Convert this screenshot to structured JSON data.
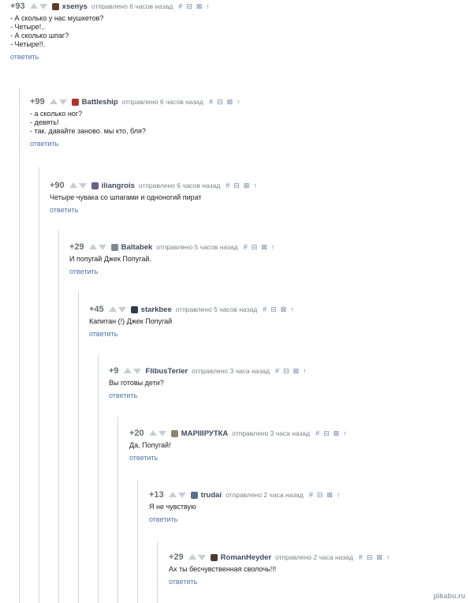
{
  "icons": {
    "hash": "#",
    "save": "⊟",
    "picture": "⊠",
    "parent": "↑"
  },
  "comments": [
    {
      "score": "+93",
      "user": "xsenys",
      "posted": "отправлено 6 часов назад",
      "avatar_color": "#5a3d2b",
      "lines": [
        "- А сколько у нас мушкетов?",
        "- Четыре!..",
        "- А сколько шпаг?",
        "- Четыре!!."
      ],
      "reply": "ответить"
    },
    {
      "score": "+99",
      "user": "Battleship",
      "posted": "отправлено 6 часов назад",
      "avatar_color": "#b0302a",
      "lines": [
        "- а сколько ног?",
        "- девять!",
        "- так. давайте заново. мы кто, бля?"
      ],
      "reply": "ответить"
    },
    {
      "score": "+90",
      "user": "iliangrois",
      "posted": "отправлено 6 часов назад",
      "avatar_color": "#6a5d8f",
      "lines": [
        "Четыре чувака со шпагами и одноногий пират"
      ],
      "reply": "ответить"
    },
    {
      "score": "+29",
      "user": "Baltabek",
      "posted": "отправлено 5 часов назад",
      "avatar_color": "#7b8a94",
      "lines": [
        "И попугай Джек Попугай."
      ],
      "reply": "ответить"
    },
    {
      "score": "+45",
      "user": "starkbee",
      "posted": "отправлено 5 часов назад",
      "avatar_color": "#2f3b4a",
      "lines": [
        "Капитан (!) Джек Попугай"
      ],
      "reply": "ответить"
    },
    {
      "score": "+9",
      "user": "FlibusTerier",
      "posted": "отправлено 3 часа назад",
      "avatar_color": "",
      "lines": [
        "Вы готовы дети?"
      ],
      "reply": "ответить"
    },
    {
      "score": "+20",
      "user": "МАРIIIРУТКА",
      "posted": "отправлено 3 часа назад",
      "avatar_color": "#8a8470",
      "lines": [
        "Да, Попугай!"
      ],
      "reply": "ответить"
    },
    {
      "score": "+13",
      "user": "trudai",
      "posted": "отправлено 2 часа назад",
      "avatar_color": "#5c6f8c",
      "lines": [
        "Я не чувствую"
      ],
      "reply": "ответить"
    },
    {
      "score": "+29",
      "user": "RomanHeyder",
      "posted": "отправлено 2 часа назад",
      "avatar_color": "#4a3a30",
      "lines": [
        "Ах ты бесчувственная сволочь!!!"
      ],
      "reply": "ответить"
    }
  ],
  "watermark": "pikabu.ru"
}
